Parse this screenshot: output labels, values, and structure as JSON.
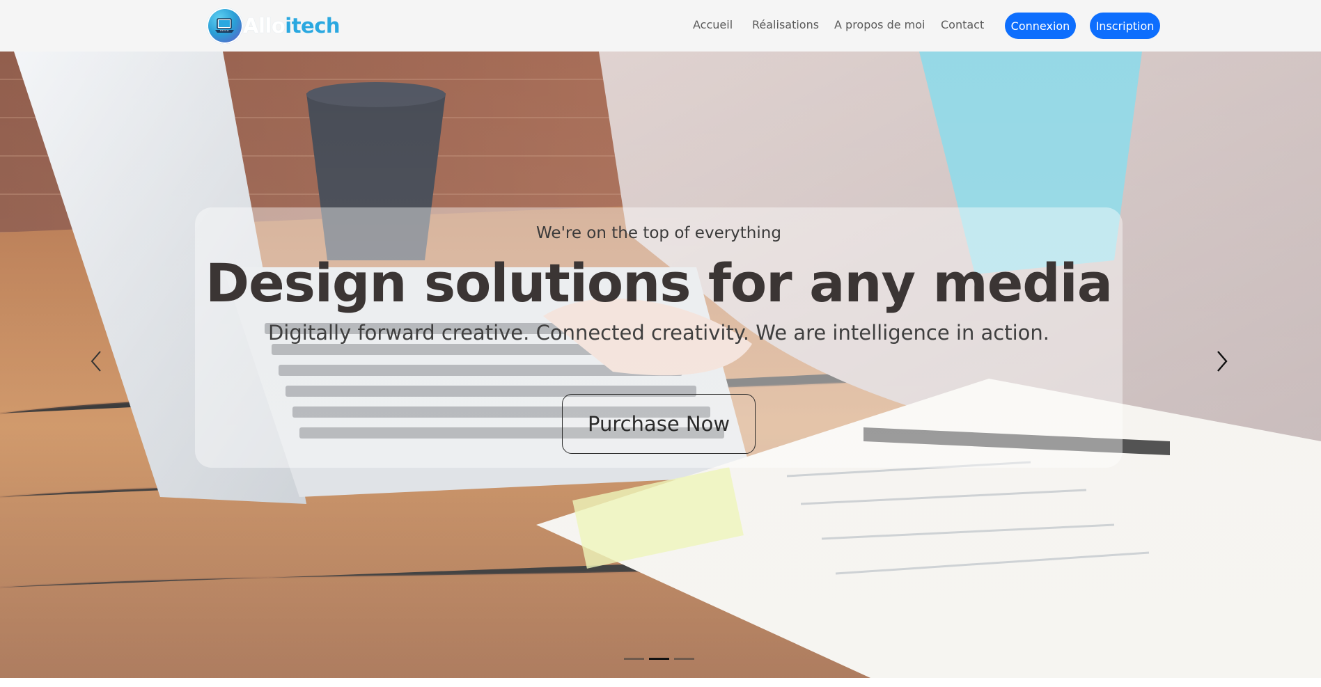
{
  "brand": {
    "name_part1": "Allo",
    "name_part2": "itech",
    "logo_icon": "laptop-icon"
  },
  "nav": {
    "links": [
      "Accueil",
      "Réalisations",
      "A propos de moi",
      "Contact"
    ],
    "login_label": "Connexion",
    "signup_label": "Inscription"
  },
  "hero": {
    "kicker": "We're on the top of everything",
    "headline": "Design solutions for any media",
    "subline": "Digitally forward creative. Connected creativity. We are intelligence in action.",
    "cta_label": "Purchase Now",
    "prev_icon": "chevron-left-icon",
    "next_icon": "chevron-right-icon",
    "slide_count": 3,
    "active_slide": 2
  },
  "colors": {
    "navbar_bg": "#f5f5f5",
    "primary_button": "#0d6efd",
    "brand_blue": "#2aa8e0",
    "nav_text": "#5a5a5a"
  }
}
